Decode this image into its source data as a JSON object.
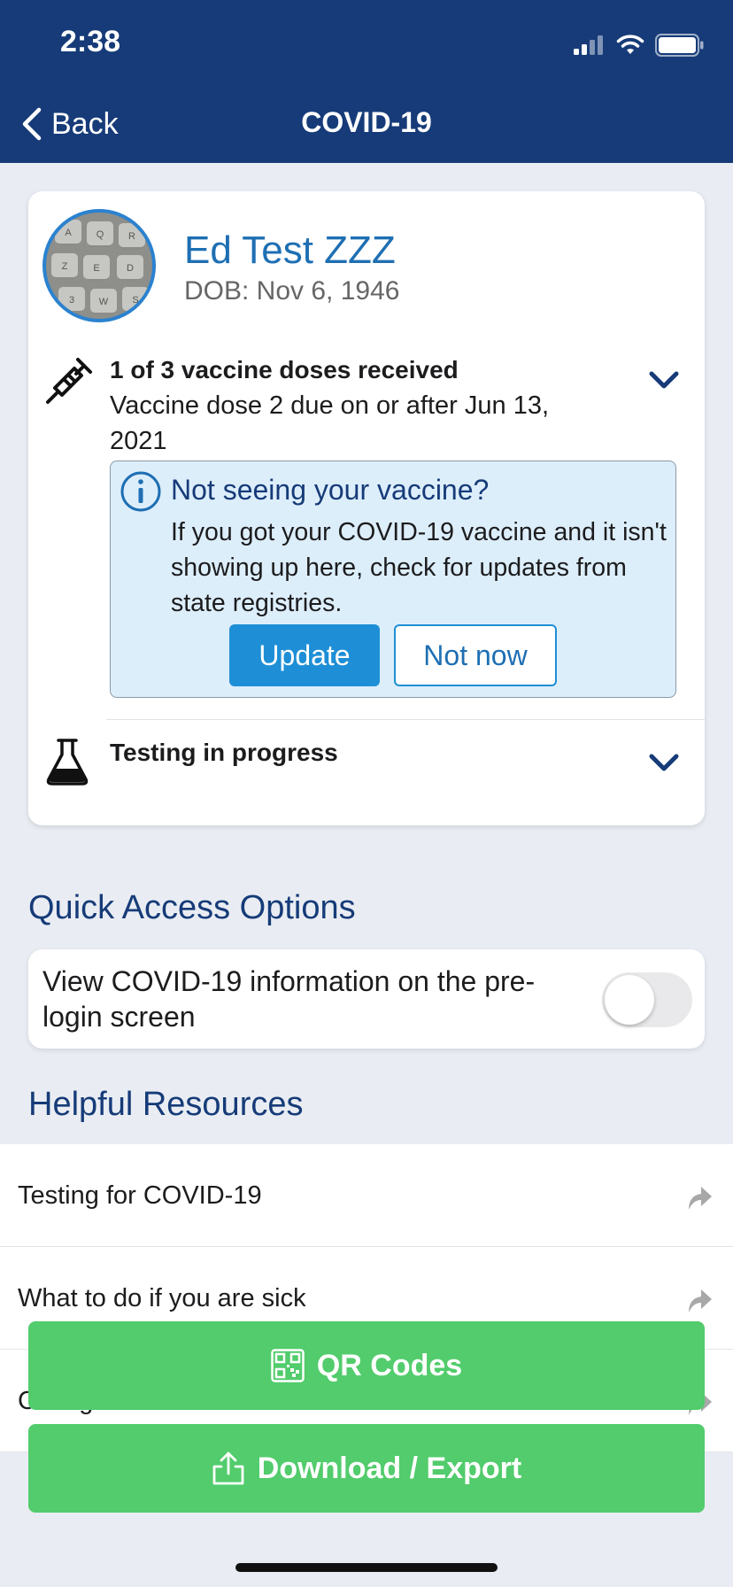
{
  "status_bar": {
    "time": "2:38"
  },
  "nav": {
    "back_label": "Back",
    "title": "COVID-19"
  },
  "patient": {
    "name": "Ed Test ZZZ",
    "dob": "DOB: Nov 6, 1946"
  },
  "vaccine": {
    "title": "1 of 3 vaccine doses received",
    "subtitle": "Vaccine dose 2 due on or after Jun 13, 2021",
    "icon": "syringe-icon"
  },
  "alert": {
    "title": "Not seeing your vaccine?",
    "body": "If you got your COVID-19 vaccine and it isn't showing up here, check for updates from state registries.",
    "update_label": "Update",
    "not_now_label": "Not now"
  },
  "testing": {
    "title": "Testing in progress",
    "icon": "flask-icon"
  },
  "quick_access": {
    "heading": "Quick Access Options",
    "option_label": "View COVID-19 information on the pre-login screen",
    "toggle_on": false
  },
  "resources": {
    "heading": "Helpful Resources",
    "items": [
      {
        "label": "Testing for COVID-19"
      },
      {
        "label": "What to do if you are sick"
      },
      {
        "label": "Caring for someone sick at home"
      }
    ]
  },
  "buttons": {
    "qr_label": "QR Codes",
    "download_label": "Download / Export"
  },
  "colors": {
    "nav_bar": "#163b78",
    "accent_blue": "#1e8fd6",
    "green_button": "#52cc6c",
    "alert_bg": "#ddeefb"
  }
}
